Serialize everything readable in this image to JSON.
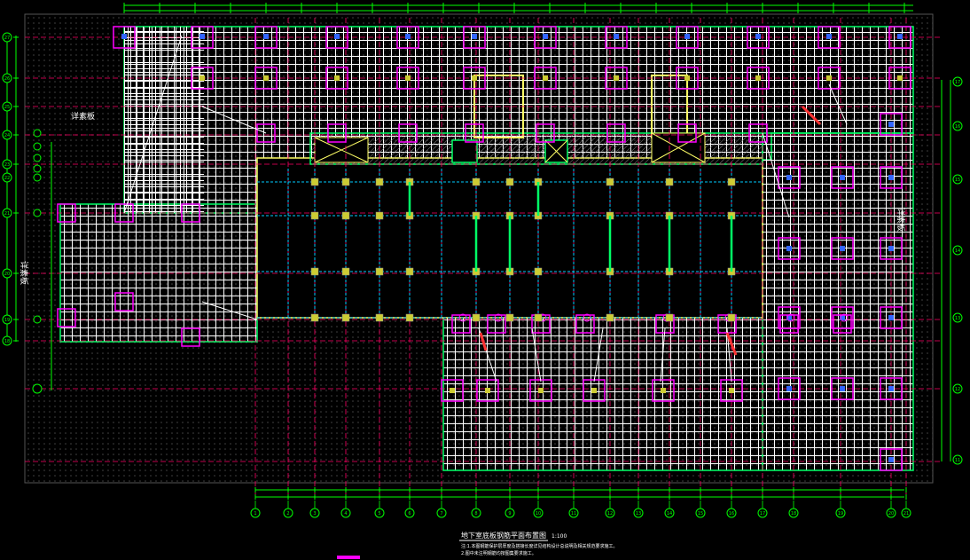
{
  "drawing": {
    "title": "地下室底板钢筋平面布置图",
    "scale": "1:100",
    "notes": [
      "注:1.本图钢筋保护层厚度及搭接长度详见结构设计总说明及相关规范要求施工。",
      "2.图中未注明钢筋均按图集要求施工。"
    ],
    "side_label_left_upper": "详素板",
    "side_label_left_lower": "详素板",
    "side_label_right": "详素板"
  },
  "axes": {
    "bottom": [
      "1",
      "2",
      "3",
      "4",
      "5",
      "6",
      "7",
      "8",
      "9",
      "10",
      "11",
      "12",
      "13",
      "14",
      "15",
      "16",
      "17",
      "18",
      "19",
      "20",
      "21"
    ],
    "left": [
      "27",
      "26",
      "25",
      "24",
      "23",
      "22",
      "21",
      "20",
      "19",
      "18"
    ],
    "right": [
      "17",
      "16",
      "15",
      "14",
      "13",
      "12",
      "11"
    ]
  },
  "colors": {
    "background": "#000000",
    "dimension": "#00ff00",
    "grid_axis": "#ff0066",
    "column_box": "#ff00ff",
    "rebar": "#ffffff",
    "beam": "#ffff66",
    "wall": "#00ff66",
    "mesh_dash": "#00ccff",
    "hatch": "#ff3333",
    "column": "#cccc33"
  }
}
